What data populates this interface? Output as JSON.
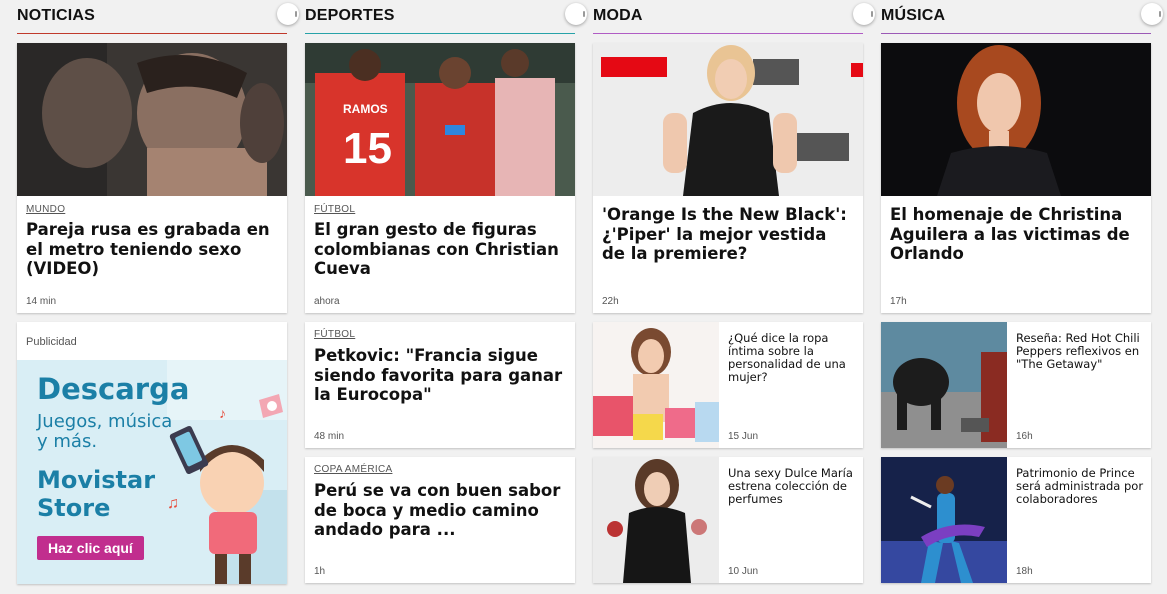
{
  "columns": [
    {
      "title": "NOTICIAS",
      "accent": "#c0392b",
      "feature": {
        "category": "MUNDO",
        "headline": "Pareja rusa es grabada en el metro teniendo sexo (VIDEO)",
        "time": "14 min"
      },
      "ad": {
        "label": "Publicidad",
        "heading": "Descarga",
        "subheading": "Juegos, música y más.",
        "brand": "Movistar Store",
        "cta": "Haz clic aquí"
      }
    },
    {
      "title": "DEPORTES",
      "accent": "#27a2a8",
      "feature": {
        "category": "FÚTBOL",
        "headline": "El gran gesto de figuras colombianas con Christian Cueva",
        "time": "ahora"
      },
      "cards": [
        {
          "category": "FÚTBOL",
          "headline": "Petkovic: \"Francia sigue siendo favorita para ganar la Eurocopa\"",
          "time": "48 min"
        },
        {
          "category": "COPA AMÉRICA",
          "headline": "Perú se va con buen sabor de boca y medio camino andado para ...",
          "time": "1h"
        }
      ]
    },
    {
      "title": "MODA",
      "accent": "#b05cc4",
      "feature": {
        "headline": "'Orange Is the New Black': ¿'Piper' la mejor vestida de la premiere?",
        "time": "22h"
      },
      "minis": [
        {
          "title": "¿Qué dice la ropa íntima sobre la personalidad de una mujer?",
          "time": "15 Jun"
        },
        {
          "title": "Una sexy Dulce María estrena colección de perfumes",
          "time": "10 Jun"
        }
      ]
    },
    {
      "title": "MÚSICA",
      "accent": "#9b59b6",
      "feature": {
        "headline": "El homenaje de Christina Aguilera a las victimas de Orlando",
        "time": "17h"
      },
      "minis": [
        {
          "title": "Reseña: Red Hot Chili Peppers reflexivos en \"The Getaway\"",
          "time": "16h"
        },
        {
          "title": "Patrimonio de Prince será administrada por colaboradores",
          "time": "18h"
        }
      ]
    }
  ]
}
